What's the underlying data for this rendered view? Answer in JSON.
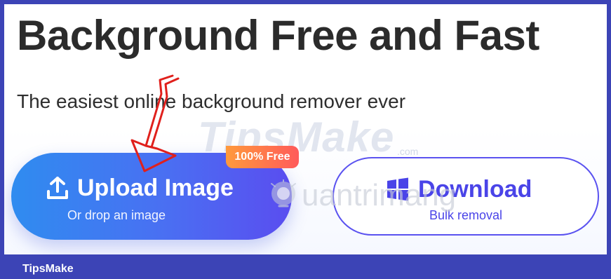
{
  "hero": {
    "title": "Background Free and Fast",
    "subtitle": "The easiest online background remover ever"
  },
  "upload_button": {
    "label": "Upload Image",
    "sublabel": "Or drop an image",
    "icon": "upload-icon",
    "badge": "100% Free"
  },
  "download_button": {
    "label": "Download",
    "sublabel": "Bulk removal",
    "icon": "windows-icon"
  },
  "watermarks": {
    "tipsmake": "TipsMake",
    "tipsmake_suffix": ".com",
    "quantrimang": "uantrimang"
  },
  "footer": {
    "brand": "TipsMake"
  },
  "colors": {
    "frame_border": "#3c44b6",
    "upload_gradient_start": "#2f8cf0",
    "upload_gradient_end": "#5a4df0",
    "download_accent": "#4a44e8",
    "badge_gradient_start": "#ff9a3c",
    "badge_gradient_end": "#ff5a5a",
    "annotation_arrow": "#e0201c"
  }
}
